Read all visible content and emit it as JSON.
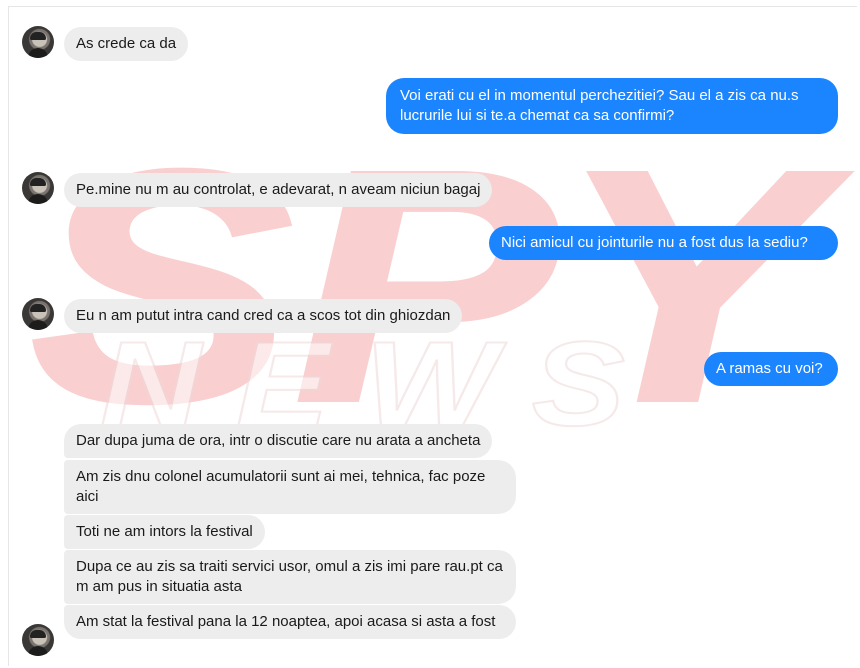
{
  "watermark": {
    "text_top": "SPY",
    "text_bottom": "NEWS",
    "color": "#e8282d"
  },
  "colors": {
    "incoming_bubble": "#ededed",
    "outgoing_bubble": "#1b84ff"
  },
  "messages": [
    {
      "sender": "contact",
      "text": "As crede ca da"
    },
    {
      "sender": "me",
      "text": "Voi erati cu el in momentul perchezitiei? Sau el a zis ca nu.s lucrurile lui si te.a chemat ca sa confirmi?"
    },
    {
      "sender": "contact",
      "text": "Pe.mine nu m au controlat, e adevarat, n aveam niciun bagaj"
    },
    {
      "sender": "me",
      "text": "Nici amicul cu jointurile nu a fost dus la sediu?"
    },
    {
      "sender": "contact",
      "text": "Eu n am putut intra cand cred ca a scos tot din ghiozdan"
    },
    {
      "sender": "me",
      "text": "A ramas cu voi?"
    },
    {
      "sender": "contact",
      "text": "Dar dupa juma de ora, intr o discutie care nu arata a ancheta"
    },
    {
      "sender": "contact",
      "text": "Am zis dnu colonel acumulatorii sunt ai mei, tehnica, fac poze aici"
    },
    {
      "sender": "contact",
      "text": "Toti ne am intors la festival"
    },
    {
      "sender": "contact",
      "text": "Dupa ce au zis sa traiti servici usor, omul a zis imi pare rau.pt ca m am pus in situatia asta"
    },
    {
      "sender": "contact",
      "text": "Am stat la festival pana la 12 noaptea, apoi acasa si asta a fost"
    }
  ]
}
